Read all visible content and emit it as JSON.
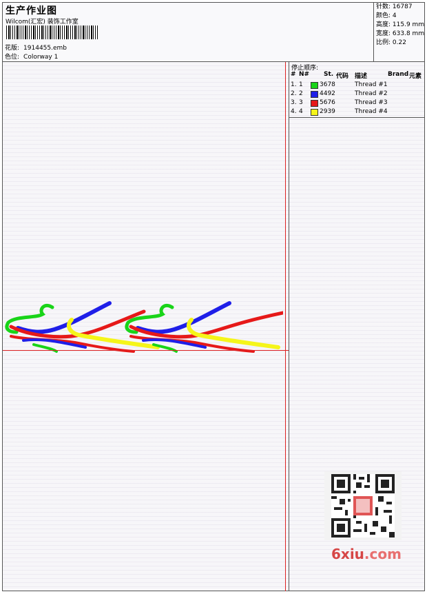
{
  "header": {
    "title": "生产作业图",
    "company": "Wilcom(汇宏) 装饰工作室",
    "pattern_label": "花版:",
    "pattern_value": "1914455.emb",
    "colorway_label": "色位:",
    "colorway_value": "Colorway 1"
  },
  "stats": [
    {
      "label": "针数:",
      "value": "16787"
    },
    {
      "label": "颜色:",
      "value": "4"
    },
    {
      "label": "高度:",
      "value": "115.9 mm"
    },
    {
      "label": "宽度:",
      "value": "633.8 mm"
    },
    {
      "label": "比例:",
      "value": "0.22"
    }
  ],
  "stop_sequence": {
    "title": "停止顺序:",
    "columns": {
      "num": "#",
      "n": "N#",
      "st": "St.",
      "code": "代码",
      "desc": "描述",
      "brand": "Brand",
      "element": "元素"
    },
    "rows": [
      {
        "num": "1.",
        "n": "1",
        "color": "#19d419",
        "code": "3678",
        "desc": "Thread #1"
      },
      {
        "num": "2.",
        "n": "2",
        "color": "#1f1fe8",
        "code": "4492",
        "desc": "Thread #2"
      },
      {
        "num": "3.",
        "n": "3",
        "color": "#e61919",
        "code": "5676",
        "desc": "Thread #3"
      },
      {
        "num": "4.",
        "n": "4",
        "color": "#f5f51a",
        "code": "2939",
        "desc": "Thread #4"
      }
    ]
  },
  "design_colors": {
    "green": "#19d419",
    "blue": "#1f1fe8",
    "red": "#e61919",
    "yellow": "#f5f51a"
  },
  "watermark": {
    "text_a": "6xiu",
    "text_b": ".com"
  }
}
